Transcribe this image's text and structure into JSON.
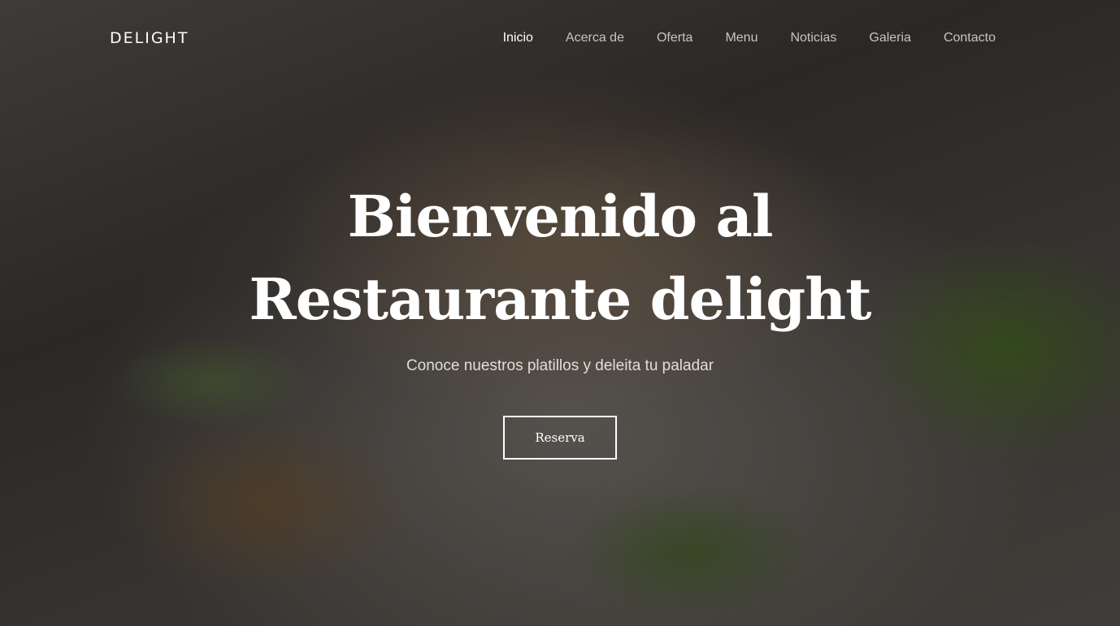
{
  "brand": {
    "name": "DELIGHT"
  },
  "nav": {
    "items": [
      {
        "label": "Inicio",
        "active": true
      },
      {
        "label": "Acerca de",
        "active": false
      },
      {
        "label": "Oferta",
        "active": false
      },
      {
        "label": "Menu",
        "active": false
      },
      {
        "label": "Noticias",
        "active": false
      },
      {
        "label": "Galeria",
        "active": false
      },
      {
        "label": "Contacto",
        "active": false
      }
    ]
  },
  "hero": {
    "title": "Bienvenido al Restaurante delight",
    "subtitle": "Conoce nuestros platillos y deleita tu paladar",
    "cta_label": "Reserva",
    "background_image": "plated-grilled-pork-chop-with-potatoes-and-broccolini"
  },
  "colors": {
    "text_primary": "#ffffff",
    "overlay": "rgba(0,0,0,0.28)"
  }
}
